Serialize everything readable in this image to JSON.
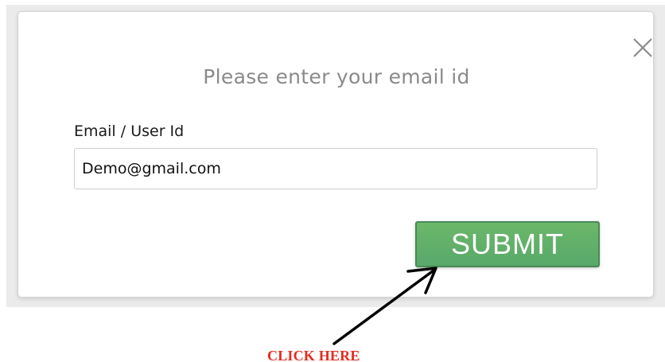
{
  "modal": {
    "title": "Please enter your email id",
    "email_label": "Email / User Id",
    "email_value": "Demo@gmail.com",
    "submit_label": "SUBMIT",
    "close_icon": "close-icon"
  },
  "annotation": {
    "text": "CLICK HERE",
    "color": "#e52b1f",
    "arrow_icon": "arrow-icon"
  },
  "colors": {
    "submit_bg": "#5fae69",
    "title_text": "#8a8a8a"
  }
}
